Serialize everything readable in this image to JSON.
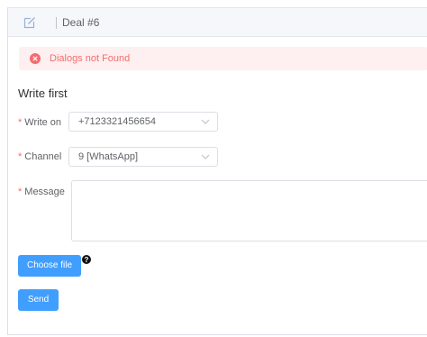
{
  "header": {
    "title": "Deal #6",
    "icon": "edit-icon"
  },
  "alert": {
    "message": "Dialogs not Found",
    "icon": "error-circle-icon",
    "color": "#f56c6c"
  },
  "form": {
    "section_title": "Write first",
    "required_mark": "*",
    "write_on": {
      "label": "Write on",
      "value": "+7123321456654"
    },
    "channel": {
      "label": "Channel",
      "value": "9 [WhatsApp]"
    },
    "message": {
      "label": "Message",
      "value": ""
    },
    "choose_file_label": "Choose file",
    "send_label": "Send"
  },
  "colors": {
    "primary": "#409eff",
    "danger": "#f56c6c",
    "header_bg": "#f5f7fa"
  }
}
